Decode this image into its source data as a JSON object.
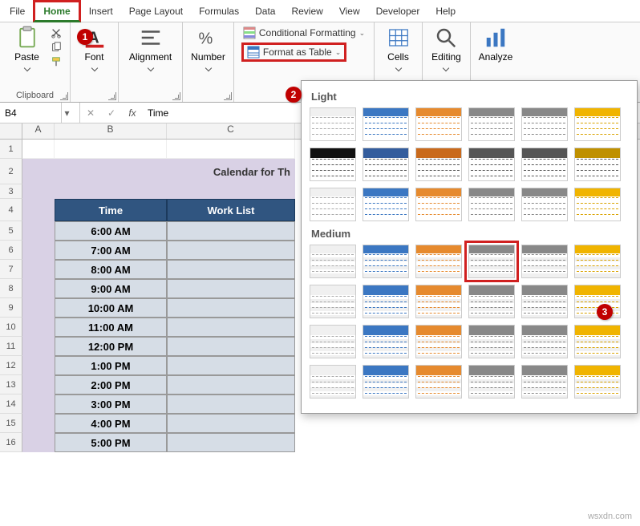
{
  "tabs": {
    "file": "File",
    "home": "Home",
    "insert": "Insert",
    "page_layout": "Page Layout",
    "formulas": "Formulas",
    "data": "Data",
    "review": "Review",
    "view": "View",
    "developer": "Developer",
    "help": "Help"
  },
  "ribbon": {
    "clipboard": {
      "paste": "Paste",
      "label": "Clipboard"
    },
    "font": {
      "big": "Font",
      "label": "Font"
    },
    "alignment": {
      "big": "Alignment",
      "label": ""
    },
    "number": {
      "big": "Number",
      "label": ""
    },
    "styles": {
      "cond": "Conditional Formatting",
      "fmt_table": "Format as Table",
      "label": ""
    },
    "cells": {
      "big": "Cells",
      "label": ""
    },
    "editing": {
      "big": "Editing",
      "label": ""
    },
    "analyze": {
      "big": "Analyze",
      "label": ""
    }
  },
  "callouts": {
    "c1": "1",
    "c2": "2",
    "c3": "3"
  },
  "name_box": "B4",
  "fx_btns": {
    "cancel": "✕",
    "enter": "✓",
    "fx": "fx"
  },
  "formula": "Time",
  "columns": [
    "A",
    "B",
    "C"
  ],
  "title": "Calendar for Th",
  "table": {
    "headers": [
      "Time",
      "Work List"
    ],
    "times": [
      "6:00 AM",
      "7:00 AM",
      "8:00 AM",
      "9:00 AM",
      "10:00 AM",
      "11:00 AM",
      "12:00 PM",
      "1:00 PM",
      "2:00 PM",
      "3:00 PM",
      "4:00 PM",
      "5:00 PM"
    ]
  },
  "gallery": {
    "light": "Light",
    "medium": "Medium"
  },
  "watermark": "wsxdn.com"
}
